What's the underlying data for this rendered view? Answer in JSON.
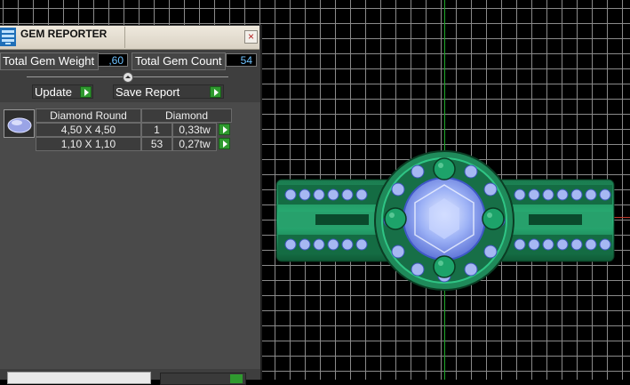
{
  "panel": {
    "title": "GEM REPORTER",
    "close_glyph": "×",
    "icons": {
      "app": "gem-reporter-app-icon",
      "close": "close-icon"
    }
  },
  "summary": {
    "weight_label": "Total Gem Weight",
    "weight_value": ",60",
    "count_label": "Total Gem Count",
    "count_value": "54"
  },
  "actions": {
    "update_label": "Update",
    "save_label": "Save Report"
  },
  "gem_table": {
    "header": {
      "shape": "Diamond Round",
      "material": "Diamond"
    },
    "rows": [
      {
        "size": "4,50 X 4,50",
        "count": "1",
        "weight": "0,33tw"
      },
      {
        "size": "1,10 X 1,10",
        "count": "53",
        "weight": "0,27tw"
      }
    ]
  },
  "colors": {
    "ring": "#1f8a5a",
    "gem": "#8fa8f5",
    "value_text": "#6fc2ff",
    "play_button": "#2f9a2f"
  }
}
